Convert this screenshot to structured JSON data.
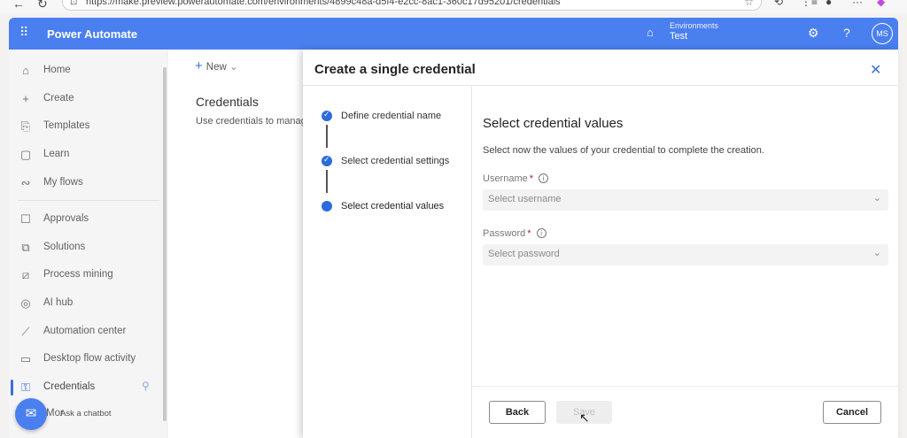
{
  "browser": {
    "url": "https://make.preview.powerautomate.com/environments/4899c48a-d5f4-e2cc-8ac1-360c17d95201/credentials"
  },
  "header": {
    "app_title": "Power Automate",
    "env_label": "Environments",
    "env_name": "Test",
    "avatar_initials": "MS",
    "brand_color": "#4a7ff0"
  },
  "nav": {
    "items": [
      {
        "label": "Home",
        "icon": "home-icon"
      },
      {
        "label": "Create",
        "icon": "plus-icon"
      },
      {
        "label": "Templates",
        "icon": "templates-icon"
      },
      {
        "label": "Learn",
        "icon": "book-icon"
      },
      {
        "label": "My flows",
        "icon": "flows-icon"
      },
      {
        "label": "Approvals",
        "icon": "approvals-icon"
      },
      {
        "label": "Solutions",
        "icon": "solutions-icon"
      },
      {
        "label": "Process mining",
        "icon": "process-mining-icon"
      },
      {
        "label": "AI hub",
        "icon": "ai-hub-icon"
      },
      {
        "label": "Automation center",
        "icon": "chart-icon"
      },
      {
        "label": "Desktop flow activity",
        "icon": "desktop-icon"
      },
      {
        "label": "Credentials",
        "icon": "credentials-icon",
        "active": true
      },
      {
        "label": "Mor",
        "icon": "more-icon"
      }
    ],
    "chatbot_label": "Ask a chatbot"
  },
  "page": {
    "new_label": "New",
    "title": "Credentials",
    "subtitle": "Use credentials to manag"
  },
  "panel": {
    "title": "Create a single credential",
    "steps": [
      {
        "label": "Define credential name",
        "state": "done"
      },
      {
        "label": "Select credential settings",
        "state": "done"
      },
      {
        "label": "Select credential values",
        "state": "current"
      }
    ],
    "section_title": "Select credential values",
    "section_desc": "Select now the values of your credential to complete the creation.",
    "username_label": "Username",
    "username_placeholder": "Select username",
    "password_label": "Password",
    "password_placeholder": "Select password",
    "back_label": "Back",
    "save_label": "Save",
    "cancel_label": "Cancel"
  }
}
